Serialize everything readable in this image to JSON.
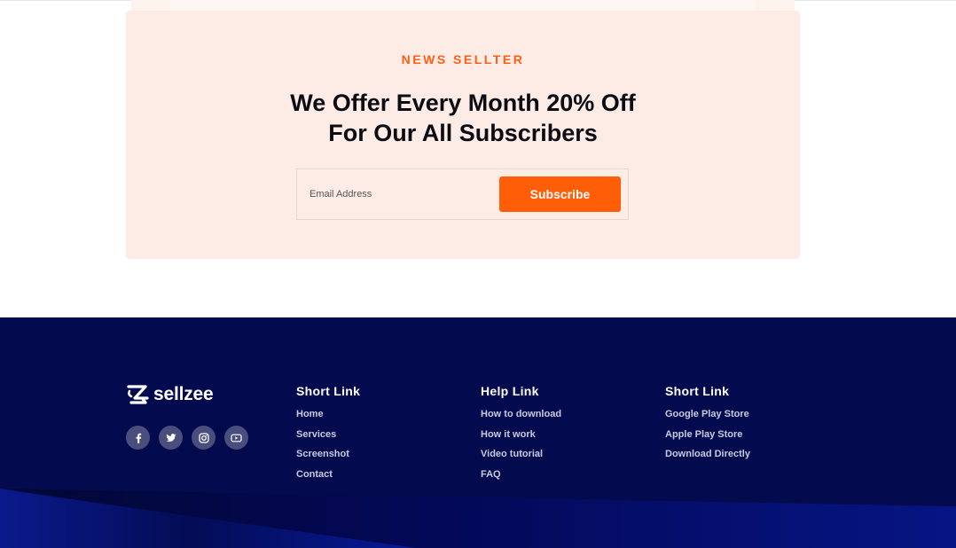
{
  "newsletter": {
    "eyebrow": "NEWS SELLTER",
    "headline_line1": "We Offer Every Month 20% Off",
    "headline_line2": "For Our All Subscribers",
    "email_placeholder": "Email Address",
    "email_value": "",
    "subscribe_label": "Subscribe"
  },
  "footer": {
    "brand_name": "sellzee",
    "brand_icon": "sellzee-logo-mark",
    "socials": [
      {
        "icon": "facebook-icon"
      },
      {
        "icon": "twitter-icon"
      },
      {
        "icon": "instagram-icon"
      },
      {
        "icon": "youtube-icon"
      }
    ],
    "columns": [
      {
        "title": "Short Link",
        "links": [
          "Home",
          "Services",
          "Screenshot",
          "Contact"
        ]
      },
      {
        "title": "Help Link",
        "links": [
          "How to download",
          "How it work",
          "Video tutorial",
          "FAQ"
        ]
      },
      {
        "title": "Short Link",
        "links": [
          "Google Play Store",
          "Apple Play Store",
          "Download Directly"
        ]
      }
    ]
  },
  "colors": {
    "accent": "#ff5e14",
    "newsletter_bg": "#fdece5",
    "footer_bg": "#030b4e",
    "headline_text": "#0c0c14"
  }
}
